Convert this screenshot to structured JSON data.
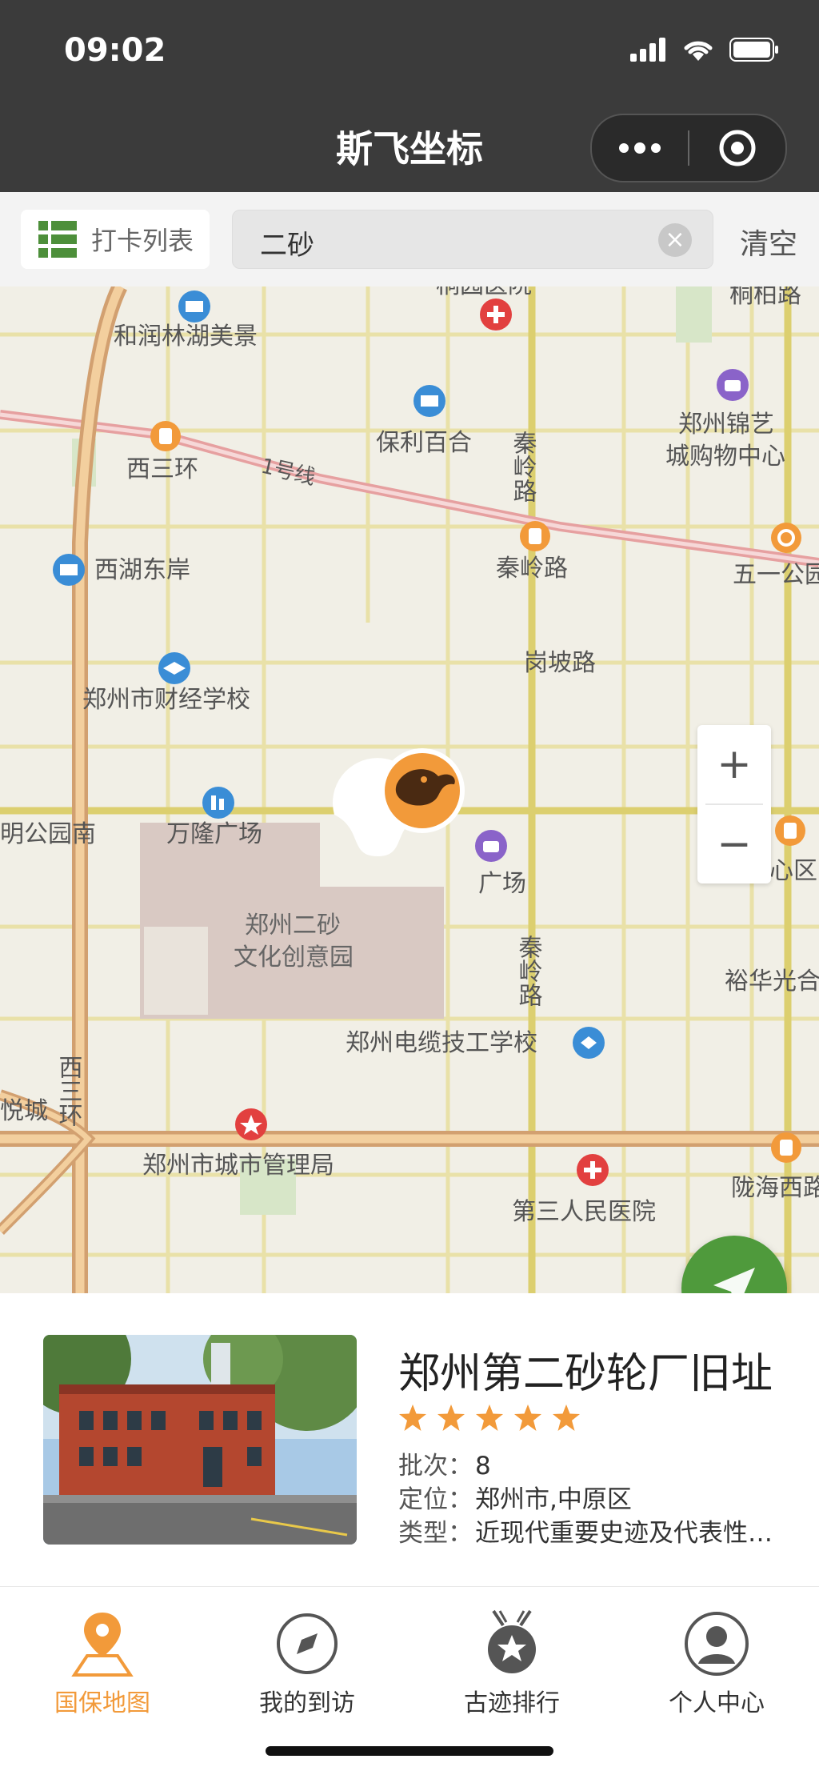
{
  "status": {
    "time": "09:02"
  },
  "nav": {
    "title": "斯飞坐标",
    "more_icon": "more-dots-icon",
    "close_icon": "target-circle-icon"
  },
  "search": {
    "list_label": "打卡列表",
    "value": "二砂",
    "clear_label": "清空"
  },
  "map": {
    "labels": {
      "top_hospital": "桐园医院",
      "tongbai": "桐柏路",
      "herun": "和润林湖美景",
      "baoli": "保利百合",
      "qinling_road_v1": "秦岭路",
      "zhengzhou_jinyi": "郑州锦艺城购物中心",
      "jinyi_line1": "郑州锦艺",
      "jinyi_line2": "城购物中心",
      "xisanhuan_station": "西三环",
      "line1": "1号线",
      "qinling_station": "秦岭路",
      "wuyi": "五一公园",
      "xihu": "西湖东岸",
      "gangpo": "岗坡路",
      "caijing": "郑州市财经学校",
      "wanlong": "万隆广场",
      "park_south": "明公园南",
      "guangchang": "广场",
      "center": "心区",
      "ersha_line1": "郑州二砂",
      "ersha_line2": "文化创意园",
      "qinling_road_v2": "秦岭路",
      "yuhua": "裕华光合",
      "dianlan": "郑州电缆技工学校",
      "xisanhuan_road": "西三环",
      "yuecheng": "悦城",
      "chengguan": "郑州市城市管理局",
      "hospital3": "第三人民医院",
      "longhai": "陇海西路"
    },
    "zoom_in": "+",
    "zoom_out": "−"
  },
  "card": {
    "name": "郑州第二砂轮厂旧址",
    "rating": 5,
    "rows": [
      {
        "key": "批次：",
        "value": "8"
      },
      {
        "key": "定位：",
        "value": "郑州市,中原区"
      },
      {
        "key": "类型：",
        "value": "近现代重要史迹及代表性…"
      }
    ]
  },
  "tabs": [
    {
      "label": "国保地图",
      "icon": "map-pin-icon",
      "active": true
    },
    {
      "label": "我的到访",
      "icon": "compass-icon",
      "active": false
    },
    {
      "label": "古迹排行",
      "icon": "ranking-badge-icon",
      "active": false
    },
    {
      "label": "个人中心",
      "icon": "user-icon",
      "active": false
    }
  ],
  "colors": {
    "accent": "#F29A3A",
    "nav_bg": "#3B3B3B",
    "locate_green": "#4F9A3C"
  }
}
